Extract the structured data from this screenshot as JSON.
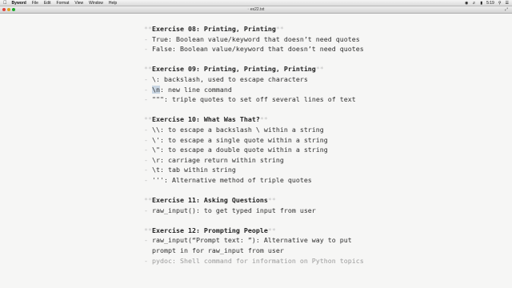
{
  "menubar": {
    "app": "Byword",
    "menus": [
      "File",
      "Edit",
      "Format",
      "View",
      "Window",
      "Help"
    ],
    "clock": "5:19"
  },
  "window": {
    "title": "ex22.txt"
  },
  "sections": [
    {
      "heading": "Exercise 08: Printing, Printing",
      "items": [
        "True: Boolean value/keyword that doesn’t need quotes",
        "False: Boolean value/keyword that doesn’t need quotes"
      ]
    },
    {
      "heading": "Exercise 09: Printing, Printing, Printing",
      "items": [
        {
          "code": "\\",
          "rest": ": backslash, used to escape characters"
        },
        {
          "code": "\\n",
          "rest": ": new line command"
        },
        {
          "code": "\"\"\"",
          "rest": ": triple quotes to set off several lines of text"
        }
      ]
    },
    {
      "heading": "Exercise 10: What Was That?",
      "items": [
        "\\\\: to escape a backslash \\ within a string",
        "\\': to escape a single quote within a string",
        "\\\": to escape a double quote within a string",
        "\\r: carriage return within string",
        "\\t: tab within string",
        "''': Alternative method of triple quotes"
      ]
    },
    {
      "heading": "Exercise 11: Asking Questions",
      "items": [
        "raw_input(): to get typed input from user"
      ]
    },
    {
      "heading": "Exercise 12: Prompting People",
      "items": [
        "raw_input(“Prompt text: ”): Alternative way to put",
        "prompt in for raw_input from user",
        "pydoc: Shell command for information on Python topics"
      ]
    }
  ],
  "marks": {
    "heading_mark": "**",
    "bullet": "-"
  }
}
